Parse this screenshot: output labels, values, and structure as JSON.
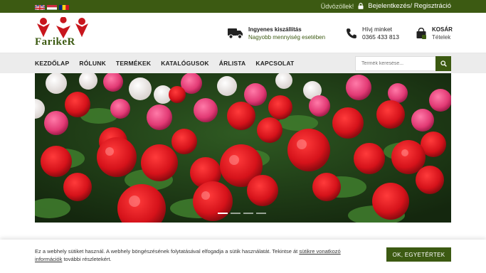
{
  "topbar": {
    "languages": [
      "English",
      "Magyar",
      "Română"
    ],
    "welcome": "Üdvözöllek!",
    "login": "Bejelentkezés",
    "separator": "/",
    "register": "Regisztráció"
  },
  "logo": {
    "text": "FarikeR"
  },
  "shipping": {
    "title": "Ingyenes kiszállítás",
    "subtitle": "Nagyobb mennyiség esetében"
  },
  "contact": {
    "title": "Hívj minket",
    "phone": "0365 433 813"
  },
  "cart": {
    "title": "KOSÁR",
    "subtitle": "Tételek"
  },
  "nav": {
    "items": [
      "KEZDŐLAP",
      "RÓLUNK",
      "TERMÉKEK",
      "KATALÓGUSOK",
      "ÁRLISTA",
      "KAPCSOLAT"
    ]
  },
  "search": {
    "placeholder": "Termék keresése..."
  },
  "slider": {
    "slide_count": 4,
    "active_index": 0
  },
  "cookie": {
    "text_before": "Ez a webhely sütiket használ. A webhely böngészésének folytatásával elfogadja a sütik használatát. Tekintse át ",
    "link": "sütikre vonatkozó információk",
    "text_after": " további részletekért.",
    "button": "OK, EGYETÉRTEK"
  },
  "colors": {
    "brand_green": "#3c5a12",
    "accent_red": "#c8161d"
  }
}
